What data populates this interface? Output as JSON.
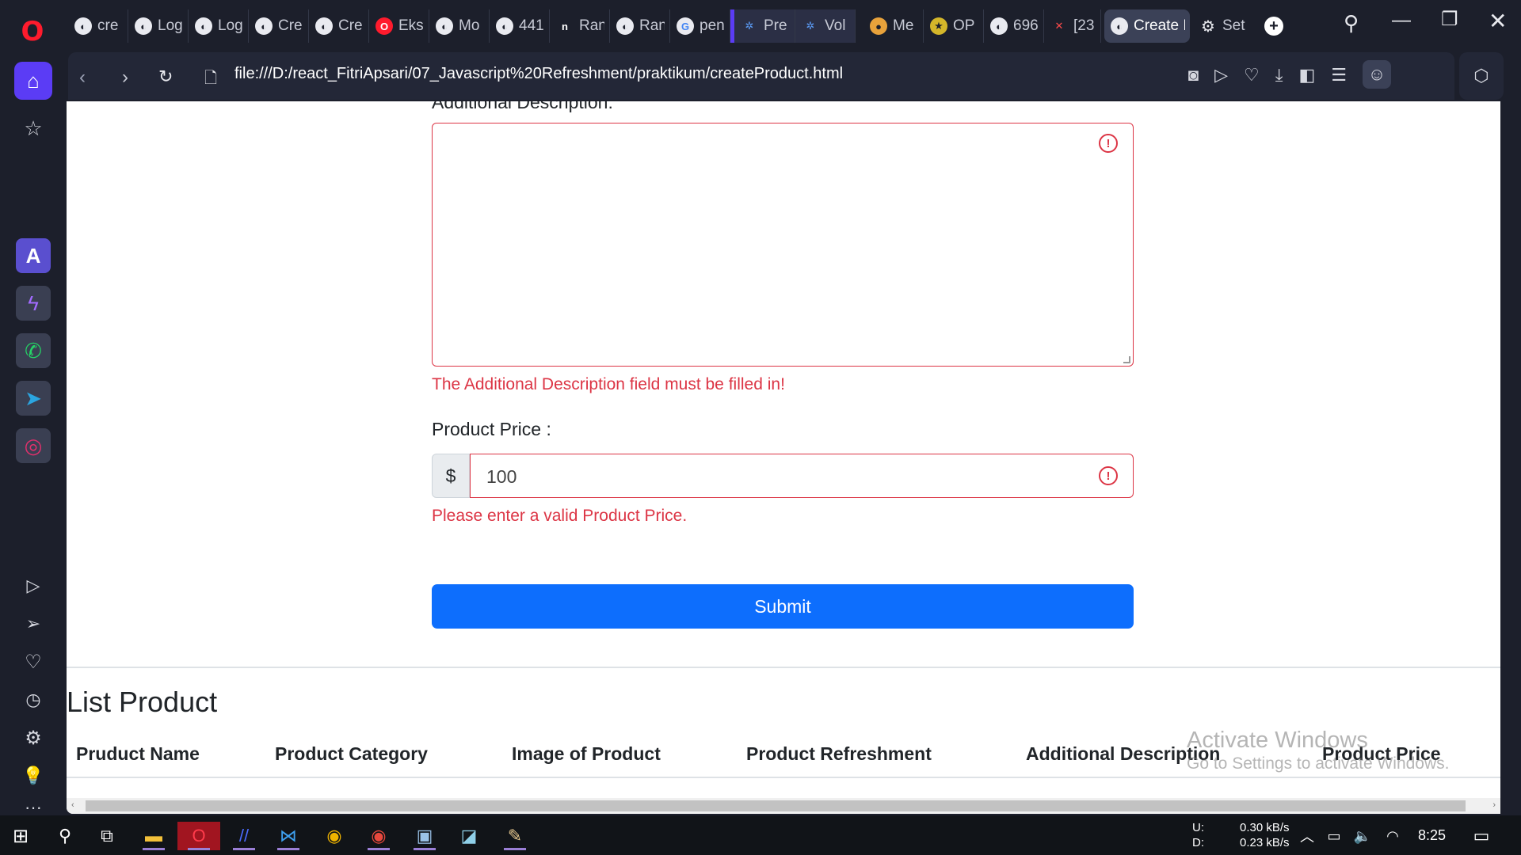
{
  "browser": {
    "tabs": [
      {
        "label": "cre"
      },
      {
        "label": "Log"
      },
      {
        "label": "Log"
      },
      {
        "label": "Cre"
      },
      {
        "label": "Cre"
      },
      {
        "label": "Eks"
      },
      {
        "label": "Mo"
      },
      {
        "label": "441"
      },
      {
        "label": "Ran"
      },
      {
        "label": "Ran"
      },
      {
        "label": "pen"
      },
      {
        "label": "Pre"
      },
      {
        "label": "Vol"
      },
      {
        "label": "Me"
      },
      {
        "label": "OP"
      },
      {
        "label": "696"
      },
      {
        "label": "[23"
      },
      {
        "label": "Create I"
      },
      {
        "label": "Set"
      }
    ],
    "active_tab": "Create I",
    "url": "file:///D:/react_FitriApsari/07_Javascript%20Refreshment/praktikum/createProduct.html"
  },
  "form": {
    "description_label": "Additional Description:",
    "description_value": "",
    "description_error": "The Additional Description field must be filled in!",
    "price_label": "Product Price :",
    "price_prefix": "$",
    "price_value": "100",
    "price_error": "Please enter a valid Product Price.",
    "submit_label": "Submit"
  },
  "list": {
    "title": "List Product",
    "columns": [
      "Pruduct Name",
      "Product Category",
      "Image of Product",
      "Product Refreshment",
      "Additional Description",
      "Product Price"
    ]
  },
  "watermark": {
    "line1": "Activate Windows",
    "line2": "Go to Settings to activate Windows."
  },
  "system": {
    "net_up_label": "U:",
    "net_down_label": "D:",
    "net_up": "0.30 kB/s",
    "net_down": "0.23 kB/s",
    "time": "8:25"
  },
  "colors": {
    "accent": "#0d6efd",
    "error": "#dc3545",
    "opera_red": "#ff1b2d",
    "sidebar_active": "#5b3cf5"
  }
}
